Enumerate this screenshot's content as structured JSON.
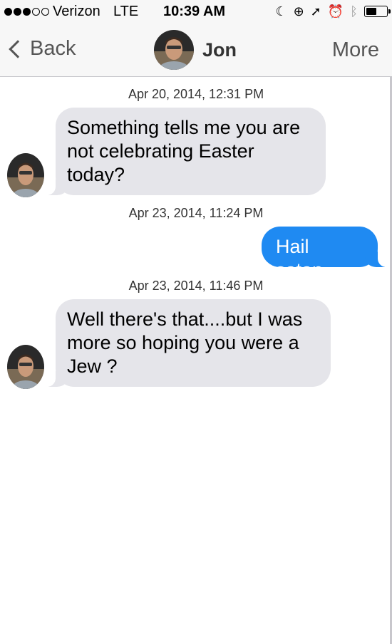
{
  "status_bar": {
    "carrier": "Verizon",
    "network": "LTE",
    "time": "10:39 AM",
    "signal_bars_filled": 3,
    "signal_bars_total": 5,
    "battery_level": 0.55,
    "icons": [
      "moon-icon",
      "rotation-lock-icon",
      "location-arrow-icon",
      "alarm-icon",
      "bluetooth-icon",
      "battery-icon"
    ]
  },
  "nav": {
    "back_label": "Back",
    "contact_name": "Jon",
    "more_label": "More"
  },
  "conversation": [
    {
      "timestamp": "Apr 20, 2014, 12:31 PM",
      "direction": "incoming",
      "text": "Something tells me you are not celebrating Easter today?"
    },
    {
      "timestamp": "Apr 23, 2014, 11:24 PM",
      "direction": "outgoing",
      "text": "Hail satan."
    },
    {
      "timestamp": "Apr 23, 2014, 11:46 PM",
      "direction": "incoming",
      "text": "Well there's that....but I was more so hoping you were a Jew ?"
    }
  ],
  "colors": {
    "incoming_bubble": "#e5e5ea",
    "outgoing_bubble": "#1f8af2",
    "bar_background": "#f7f7f7"
  }
}
